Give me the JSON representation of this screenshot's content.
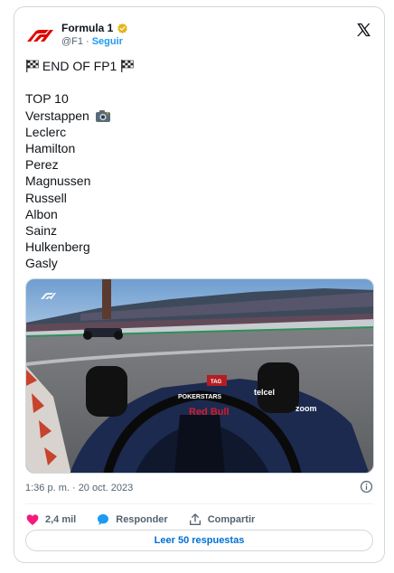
{
  "account": {
    "display_name": "Formula 1",
    "handle": "@F1",
    "separator": "·",
    "follow_label": "Seguir"
  },
  "tweet": {
    "headline": "END OF FP1",
    "list_title": "TOP 10",
    "drivers": [
      "Verstappen",
      "Leclerc",
      "Hamilton",
      "Perez",
      "Magnussen",
      "Russell",
      "Albon",
      "Sainz",
      "Hulkenberg",
      "Gasly"
    ]
  },
  "media": {
    "car_sponsors": [
      "POKERSTARS",
      "telcel",
      "Red Bull",
      "zoom",
      "TAG"
    ]
  },
  "footer": {
    "timestamp": "1:36 p. m. · 20 oct. 2023",
    "likes": "2,4 mil",
    "reply_label": "Responder",
    "share_label": "Compartir",
    "read_replies": "Leer 50 respuestas"
  },
  "icons": {
    "logo": "f1-logo-icon",
    "verified": "verified-badge-icon",
    "x": "x-logo-icon",
    "flag": "checkered-flag-icon",
    "camera": "camera-flash-icon",
    "info": "info-icon",
    "heart": "heart-icon",
    "reply": "speech-bubble-icon",
    "share": "share-upload-icon"
  },
  "colors": {
    "f1_red": "#e10600",
    "verified_gold": "#e2b719",
    "link_blue": "#1d9bf0",
    "heart_pink": "#f91880",
    "muted_text": "#536471",
    "border": "#cfd9de"
  }
}
